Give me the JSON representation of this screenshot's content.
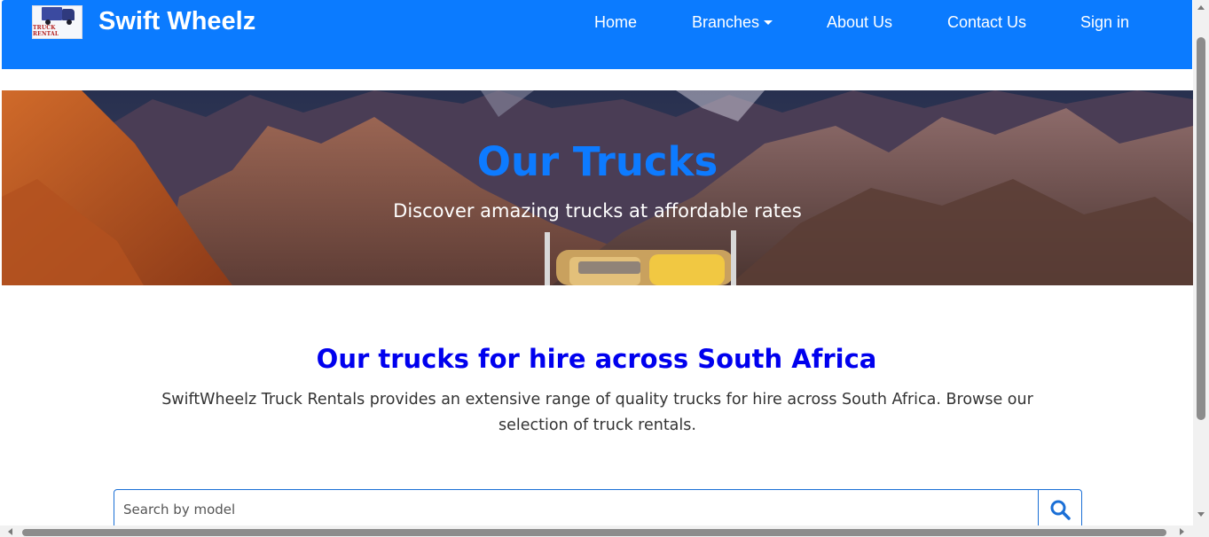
{
  "navbar": {
    "logo_text": "TRUCK RENTAL",
    "brand": "Swift Wheelz",
    "links": {
      "home": "Home",
      "branches": "Branches",
      "about": "About Us",
      "contact": "Contact Us",
      "signin": "Sign in"
    },
    "background_color": "#0b7bff"
  },
  "hero": {
    "title": "Our Trucks",
    "subtitle": "Discover amazing trucks at affordable rates",
    "title_color": "#0d7bff"
  },
  "section": {
    "title": "Our trucks for hire across South Africa",
    "description": "SwiftWheelz Truck Rentals provides an extensive range of quality trucks for hire across South Africa. Browse our selection of truck rentals.",
    "title_color": "#0000ee"
  },
  "search": {
    "placeholder": "Search by model",
    "value": "",
    "button_icon": "search-icon"
  }
}
